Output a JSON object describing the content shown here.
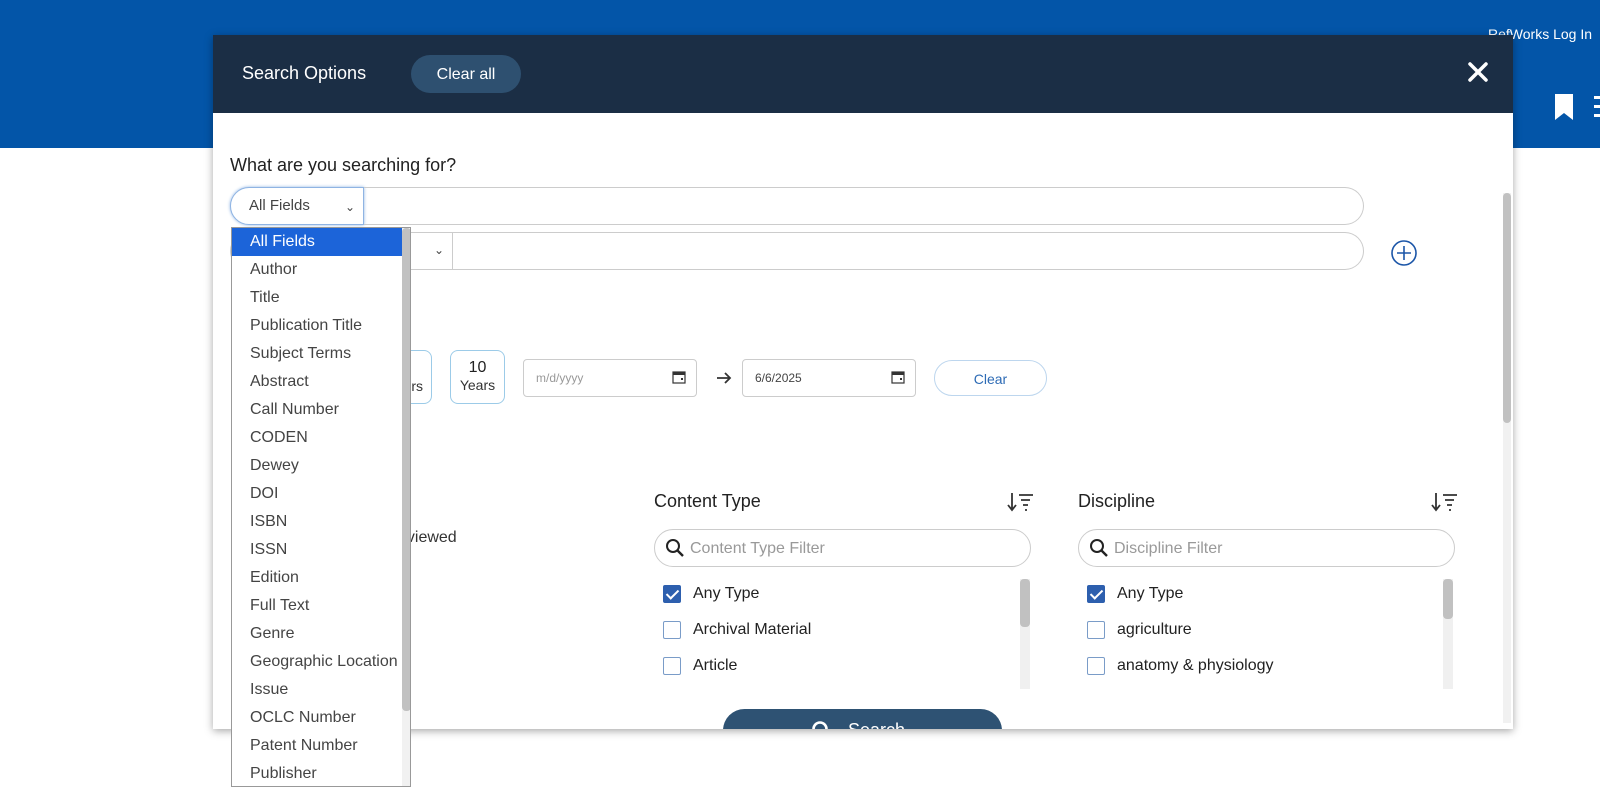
{
  "header": {
    "refworks_label": "RefWorks Log In"
  },
  "modal": {
    "title": "Search Options",
    "clear_all_label": "Clear all",
    "question": "What are you searching for?",
    "field_select_value": "All Fields",
    "years": {
      "partial_label": "rs",
      "ten_num": "10",
      "ten_label": "Years"
    },
    "date_from_placeholder": "m/d/yyyy",
    "date_to_value": "6/6/2025",
    "clear_date_label": "Clear",
    "peer_partial": "eviewed",
    "content_type": {
      "title": "Content Type",
      "filter_placeholder": "Content Type Filter",
      "items": [
        {
          "label": "Any Type",
          "checked": true
        },
        {
          "label": "Archival Material",
          "checked": false
        },
        {
          "label": "Article",
          "checked": false
        }
      ]
    },
    "discipline": {
      "title": "Discipline",
      "filter_placeholder": "Discipline Filter",
      "items": [
        {
          "label": "Any Type",
          "checked": true
        },
        {
          "label": "agriculture",
          "checked": false
        },
        {
          "label": "anatomy & physiology",
          "checked": false
        }
      ]
    },
    "search_label": "Search"
  },
  "dropdown": {
    "selected": "All Fields",
    "options": [
      "All Fields",
      "Author",
      "Title",
      "Publication Title",
      "Subject Terms",
      "Abstract",
      "Call Number",
      "CODEN",
      "Dewey",
      "DOI",
      "ISBN",
      "ISSN",
      "Edition",
      "Full Text",
      "Genre",
      "Geographic Location",
      "Issue",
      "OCLC Number",
      "Patent Number",
      "Publisher"
    ]
  },
  "colors": {
    "topbar": "#0355a8",
    "modal_header": "#1b2e45",
    "accent": "#1c64d9",
    "search_button": "#2e5273"
  }
}
